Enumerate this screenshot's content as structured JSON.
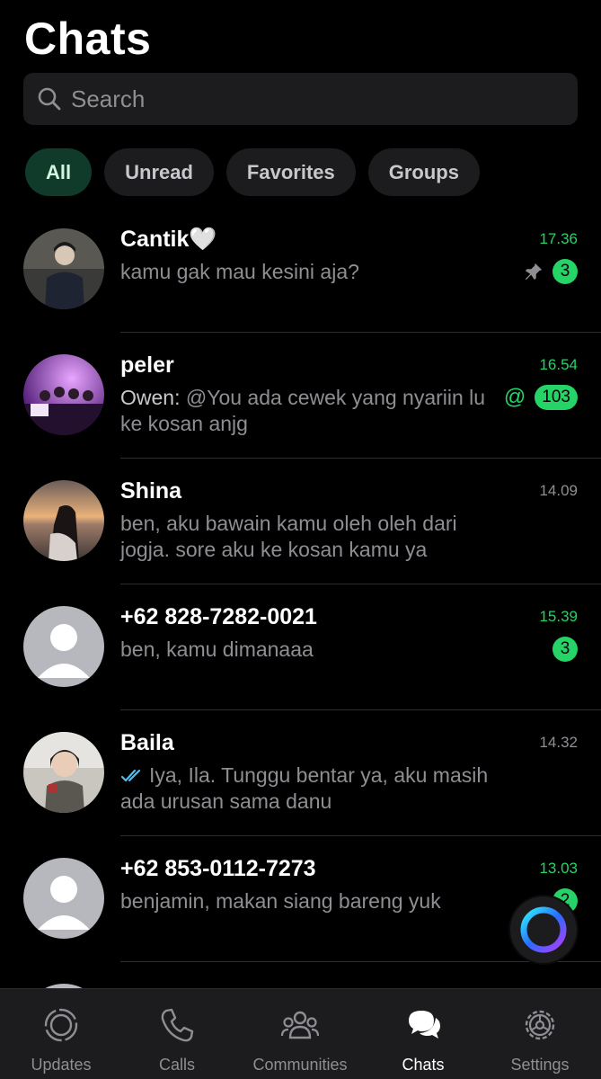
{
  "header": {
    "title": "Chats"
  },
  "search": {
    "placeholder": "Search"
  },
  "filters": [
    "All",
    "Unread",
    "Favorites",
    "Groups"
  ],
  "chats": [
    {
      "name": "Cantik🤍",
      "time": "17.36",
      "message": "kamu gak mau kesini aja?",
      "pinned": true,
      "unread": "3"
    },
    {
      "name": "peler",
      "time": "16.54",
      "sender": "Owen: ",
      "message": "@You ada cewek yang nyariin lu ke kosan anjg",
      "mention": "@",
      "unread": "103"
    },
    {
      "name": "Shina",
      "time": "14.09",
      "message": "ben, aku bawain kamu oleh oleh dari jogja. sore aku ke kosan kamu ya"
    },
    {
      "name": "+62 828-7282-0021",
      "time": "15.39",
      "message": "ben, kamu dimanaaa",
      "unread": "3"
    },
    {
      "name": "Baila",
      "time": "14.32",
      "message": "Iya, Ila. Tunggu bentar ya, aku masih ada urusan sama danu",
      "read_ticks": true
    },
    {
      "name": "+62 853-0112-7273",
      "time": "13.03",
      "message": "benjamin, makan siang bareng yuk",
      "unread": "2"
    }
  ],
  "tabs": [
    {
      "label": "Updates",
      "icon": "updates-icon"
    },
    {
      "label": "Calls",
      "icon": "phone-icon"
    },
    {
      "label": "Communities",
      "icon": "communities-icon"
    },
    {
      "label": "Chats",
      "icon": "chats-icon",
      "active": true
    },
    {
      "label": "Settings",
      "icon": "gear-icon"
    }
  ],
  "colors": {
    "accent": "#25d366",
    "background": "#000000",
    "surface": "#1c1c1e",
    "muted": "#8e8e93",
    "active_chip": "#103a29"
  }
}
